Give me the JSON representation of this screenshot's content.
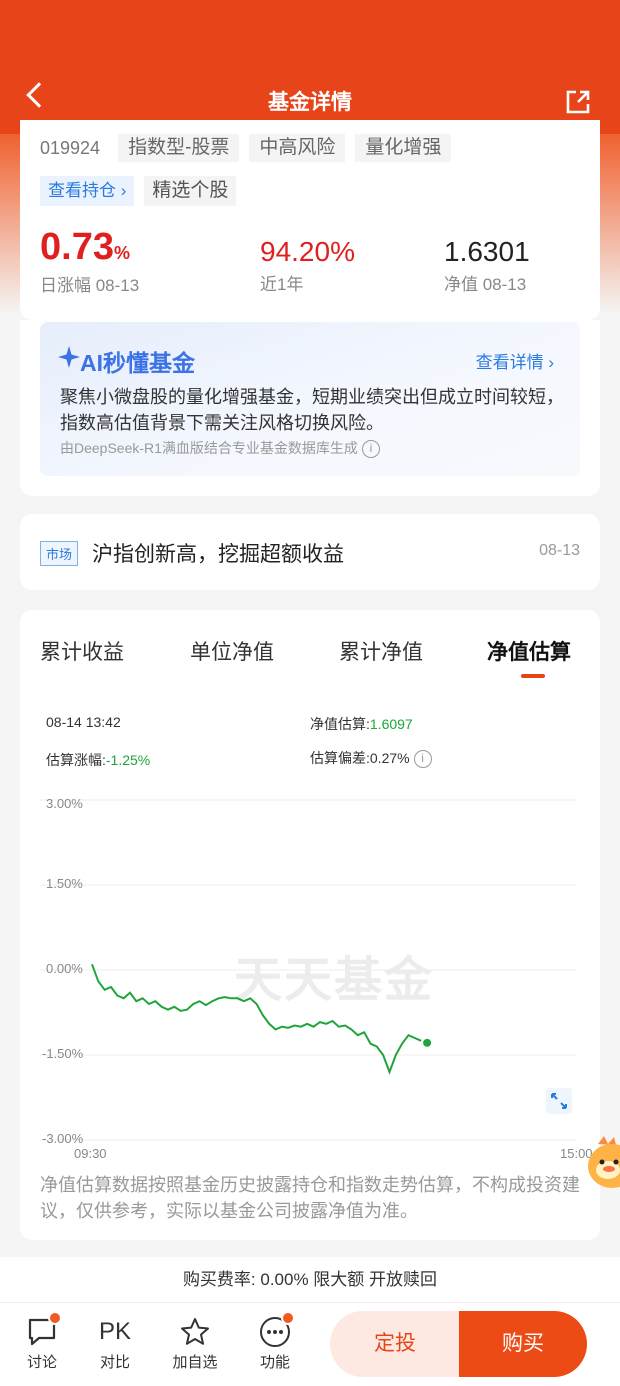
{
  "header": {
    "title": "基金详情"
  },
  "fund": {
    "code": "019924",
    "tags": [
      "指数型-股票",
      "中高风险",
      "量化增强"
    ],
    "holdings_link": "查看持仓 ›",
    "pick_tag": "精选个股",
    "day_change": "0.73",
    "day_change_unit": "%",
    "day_change_label": "日涨幅 08-13",
    "year_return": "94.20%",
    "year_return_label": "近1年",
    "nav": "1.6301",
    "nav_label": "净值 08-13"
  },
  "ai": {
    "title": "AI秒懂基金",
    "more": "查看详情 ›",
    "summary": "聚焦小微盘股的量化增强基金，短期业绩突出但成立时间较短，指数高估值背景下需关注风格切换风险。",
    "source": "由DeepSeek-R1满血版结合专业基金数据库生成"
  },
  "news": {
    "tag": "市场",
    "title": "沪指创新高，挖掘超额收益",
    "date": "08-13"
  },
  "tabs": [
    "累计收益",
    "单位净值",
    "累计净值",
    "净值估算"
  ],
  "estimate": {
    "time": "08-14 13:42",
    "value_label": "净值估算:",
    "value": "1.6097",
    "change_label": "估算涨幅:",
    "change": "-1.25%",
    "deviation_label": "估算偏差:",
    "deviation": "0.27%"
  },
  "watermark": "天天基金",
  "chart_data": {
    "type": "line",
    "x_start": "09:30",
    "x_end": "15:00",
    "y_ticks": [
      "3.00%",
      "1.50%",
      "0.00%",
      "-1.50%",
      "-3.00%"
    ],
    "ylim": [
      -3.0,
      3.0
    ],
    "series": [
      {
        "color": "#1ea53a",
        "values": [
          0.1,
          -0.2,
          -0.35,
          -0.3,
          -0.45,
          -0.5,
          -0.4,
          -0.55,
          -0.5,
          -0.6,
          -0.55,
          -0.65,
          -0.7,
          -0.65,
          -0.72,
          -0.7,
          -0.6,
          -0.55,
          -0.62,
          -0.55,
          -0.5,
          -0.48,
          -0.5,
          -0.5,
          -0.55,
          -0.5,
          -0.6,
          -0.8,
          -0.95,
          -1.05,
          -1.0,
          -1.02,
          -0.98,
          -1.0,
          -0.95,
          -1.0,
          -0.92,
          -0.95,
          -0.9,
          -1.0,
          -0.98,
          -1.05,
          -1.15,
          -1.1,
          -1.3,
          -1.35,
          -1.5,
          -1.8,
          -1.5,
          -1.3,
          -1.15,
          -1.2,
          -1.25
        ]
      }
    ],
    "grid": true
  },
  "disclaimer": "净值估算数据按照基金历史披露持仓和指数走势估算，不构成投资建议，仅供参考，实际以基金公司披露净值为准。",
  "fee": "购买费率: 0.00% 限大额 开放赎回",
  "bottom": {
    "items": [
      {
        "label": "讨论",
        "icon": "chat-icon"
      },
      {
        "label": "对比",
        "icon": "PK"
      },
      {
        "label": "加自选",
        "icon": "star-icon"
      },
      {
        "label": "功能",
        "icon": "more-icon"
      }
    ],
    "invest_button": "定投",
    "buy_button": "购买"
  }
}
